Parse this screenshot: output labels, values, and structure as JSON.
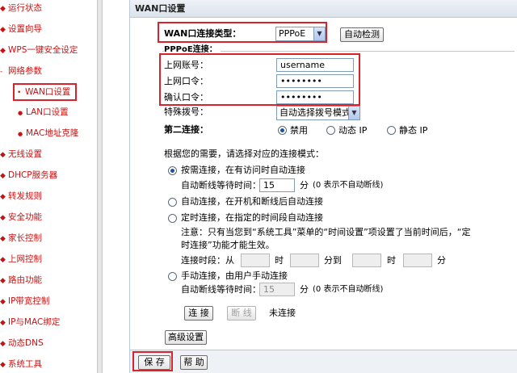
{
  "sidebar": {
    "items": [
      {
        "label": "运行状态"
      },
      {
        "label": "设置向导"
      },
      {
        "label": "WPS一键安全设定"
      },
      {
        "label": "网络参数"
      },
      {
        "label": "WAN口设置"
      },
      {
        "label": "LAN口设置"
      },
      {
        "label": "MAC地址克隆"
      },
      {
        "label": "无线设置"
      },
      {
        "label": "DHCP服务器"
      },
      {
        "label": "转发规则"
      },
      {
        "label": "安全功能"
      },
      {
        "label": "家长控制"
      },
      {
        "label": "上网控制"
      },
      {
        "label": "路由功能"
      },
      {
        "label": "IP带宽控制"
      },
      {
        "label": "IP与MAC绑定"
      },
      {
        "label": "动态DNS"
      },
      {
        "label": "系统工具"
      }
    ]
  },
  "panel": {
    "title": "WAN口设置",
    "conn_type_label": "WAN口连接类型：",
    "conn_type_value": "PPPoE",
    "auto_detect_button": "自动检测",
    "pppoe_section": "PPPoE连接：",
    "username_label": "上网账号：",
    "username_value": "username",
    "password_label": "上网口令：",
    "password_value": "••••••••",
    "confirm_label": "确认口令：",
    "confirm_value": "••••••••",
    "dial_label": "特殊拨号：",
    "dial_value": "自动选择拨号模式",
    "second_conn_label": "第二连接：",
    "second_conn_options": [
      "禁用",
      "动态 IP",
      "静态 IP"
    ],
    "mode_intro": "根据您的需要，请选择对应的连接模式：",
    "mode_on_demand": "按需连接，在有访问时自动连接",
    "idle_label_1": "自动断线等待时间：",
    "idle_value_1": "15",
    "idle_unit_1": "分",
    "idle_hint_1": "(0 表示不自动断线)",
    "mode_auto": "自动连接，在开机和断线后自动连接",
    "mode_timed": "定时连接，在指定的时间段自动连接",
    "note_line1": "注意：只有当您到“系统工具”菜单的“时间设置”项设置了当前时间后，“定",
    "note_line2": "时连接”功能才能生效。",
    "period_label": "连接时段：从",
    "period_hour": "时",
    "period_to": "分到",
    "period_hour2": "时",
    "period_min": "分",
    "mode_manual": "手动连接，由用户手动连接",
    "idle_label_2": "自动断线等待时间：",
    "idle_value_2": "15",
    "idle_unit_2": "分",
    "idle_hint_2": "(0 表示不自动断线)",
    "connect_button": "连 接",
    "disconnect_button": "断 线",
    "status_text": "未连接",
    "advanced_button": "高级设置",
    "save_button": "保 存",
    "help_button": "帮 助"
  },
  "colors": {
    "nav_text": "#cc1111",
    "highlight": "#d9232a"
  }
}
